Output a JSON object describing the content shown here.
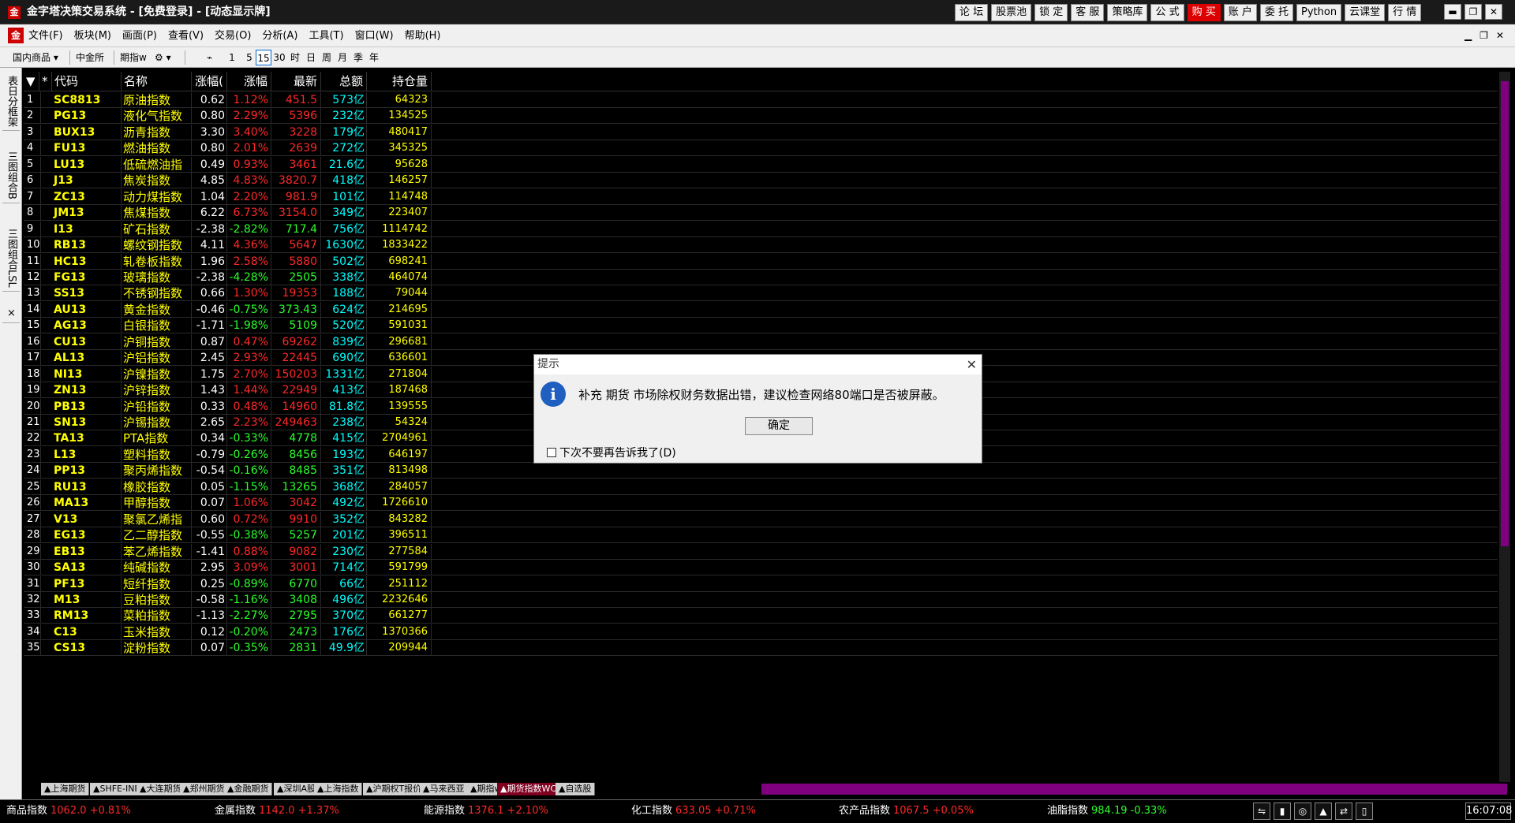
{
  "window": {
    "title": "金字塔决策交易系统 - [免费登录] - [动态显示牌]",
    "logo": "金"
  },
  "title_buttons": [
    "论 坛",
    "股票池",
    "锁 定",
    "客 服",
    "策略库",
    "公 式",
    "购 买",
    "账 户",
    "委 托",
    "Python",
    "云课堂",
    "行 情"
  ],
  "window_controls": [
    "▬",
    "❐",
    "✕"
  ],
  "menu": [
    "文件(F)",
    "板块(M)",
    "画面(P)",
    "查看(V)",
    "交易(O)",
    "分析(A)",
    "工具(T)",
    "窗口(W)",
    "帮助(H)"
  ],
  "menu_right": [
    "▁",
    "❐",
    "✕"
  ],
  "toolbar": {
    "market": "国内商品",
    "exchange": "中金所",
    "index": "期指w",
    "periods": [
      "1",
      "5",
      "15",
      "30",
      "时",
      "日",
      "周",
      "月",
      "季",
      "年"
    ],
    "selected_period": "15"
  },
  "side_tabs": [
    "表日分框架",
    "三图组合B",
    "三图组合LSL",
    "×"
  ],
  "columns": [
    "*",
    "代码",
    "名称",
    "涨幅(",
    "涨幅",
    "最新",
    "总额",
    "持仓量"
  ],
  "rows": [
    {
      "no": "1",
      "code": "SC8813",
      "name": "原油指数",
      "p1": "0.62",
      "pct": "1.12%",
      "last": "451.5",
      "amt": "573亿",
      "oi": "64323",
      "d": "up"
    },
    {
      "no": "2",
      "code": "PG13",
      "name": "液化气指数",
      "p1": "0.80",
      "pct": "2.29%",
      "last": "5396",
      "amt": "232亿",
      "oi": "134525",
      "d": "up"
    },
    {
      "no": "3",
      "code": "BUX13",
      "name": "沥青指数",
      "p1": "3.30",
      "pct": "3.40%",
      "last": "3228",
      "amt": "179亿",
      "oi": "480417",
      "d": "up"
    },
    {
      "no": "4",
      "code": "FU13",
      "name": "燃油指数",
      "p1": "0.80",
      "pct": "2.01%",
      "last": "2639",
      "amt": "272亿",
      "oi": "345325",
      "d": "up"
    },
    {
      "no": "5",
      "code": "LU13",
      "name": "低硫燃油指",
      "p1": "0.49",
      "pct": "0.93%",
      "last": "3461",
      "amt": "21.6亿",
      "oi": "95628",
      "d": "up"
    },
    {
      "no": "6",
      "code": "J13",
      "name": "焦炭指数",
      "p1": "4.85",
      "pct": "4.83%",
      "last": "3820.7",
      "amt": "418亿",
      "oi": "146257",
      "d": "up"
    },
    {
      "no": "7",
      "code": "ZC13",
      "name": "动力煤指数",
      "p1": "1.04",
      "pct": "2.20%",
      "last": "981.9",
      "amt": "101亿",
      "oi": "114748",
      "d": "up"
    },
    {
      "no": "8",
      "code": "JM13",
      "name": "焦煤指数",
      "p1": "6.22",
      "pct": "6.73%",
      "last": "3154.0",
      "amt": "349亿",
      "oi": "223407",
      "d": "up"
    },
    {
      "no": "9",
      "code": "I13",
      "name": "矿石指数",
      "p1": "-2.38",
      "pct": "-2.82%",
      "last": "717.4",
      "amt": "756亿",
      "oi": "1114742",
      "d": "dn"
    },
    {
      "no": "10",
      "code": "RB13",
      "name": "螺纹钢指数",
      "p1": "4.11",
      "pct": "4.36%",
      "last": "5647",
      "amt": "1630亿",
      "oi": "1833422",
      "d": "up"
    },
    {
      "no": "11",
      "code": "HC13",
      "name": "轧卷板指数",
      "p1": "1.96",
      "pct": "2.58%",
      "last": "5880",
      "amt": "502亿",
      "oi": "698241",
      "d": "up"
    },
    {
      "no": "12",
      "code": "FG13",
      "name": "玻璃指数",
      "p1": "-2.38",
      "pct": "-4.28%",
      "last": "2505",
      "amt": "338亿",
      "oi": "464074",
      "d": "dn"
    },
    {
      "no": "13",
      "code": "SS13",
      "name": "不锈钢指数",
      "p1": "0.66",
      "pct": "1.30%",
      "last": "19353",
      "amt": "188亿",
      "oi": "79044",
      "d": "up"
    },
    {
      "no": "14",
      "code": "AU13",
      "name": "黄金指数",
      "p1": "-0.46",
      "pct": "-0.75%",
      "last": "373.43",
      "amt": "624亿",
      "oi": "214695",
      "d": "dn"
    },
    {
      "no": "15",
      "code": "AG13",
      "name": "白银指数",
      "p1": "-1.71",
      "pct": "-1.98%",
      "last": "5109",
      "amt": "520亿",
      "oi": "591031",
      "d": "dn"
    },
    {
      "no": "16",
      "code": "CU13",
      "name": "沪铜指数",
      "p1": "0.87",
      "pct": "0.47%",
      "last": "69262",
      "amt": "839亿",
      "oi": "296681",
      "d": "up"
    },
    {
      "no": "17",
      "code": "AL13",
      "name": "沪铝指数",
      "p1": "2.45",
      "pct": "2.93%",
      "last": "22445",
      "amt": "690亿",
      "oi": "636601",
      "d": "up"
    },
    {
      "no": "18",
      "code": "NI13",
      "name": "沪镍指数",
      "p1": "1.75",
      "pct": "2.70%",
      "last": "150203",
      "amt": "1331亿",
      "oi": "271804",
      "d": "up"
    },
    {
      "no": "19",
      "code": "ZN13",
      "name": "沪锌指数",
      "p1": "1.43",
      "pct": "1.44%",
      "last": "22949",
      "amt": "413亿",
      "oi": "187468",
      "d": "up"
    },
    {
      "no": "20",
      "code": "PB13",
      "name": "沪铅指数",
      "p1": "0.33",
      "pct": "0.48%",
      "last": "14960",
      "amt": "81.8亿",
      "oi": "139555",
      "d": "up"
    },
    {
      "no": "21",
      "code": "SN13",
      "name": "沪锡指数",
      "p1": "2.65",
      "pct": "2.23%",
      "last": "249463",
      "amt": "238亿",
      "oi": "54324",
      "d": "up"
    },
    {
      "no": "22",
      "code": "TA13",
      "name": "PTA指数",
      "p1": "0.34",
      "pct": "-0.33%",
      "last": "4778",
      "amt": "415亿",
      "oi": "2704961",
      "d": "dn"
    },
    {
      "no": "23",
      "code": "L13",
      "name": "塑料指数",
      "p1": "-0.79",
      "pct": "-0.26%",
      "last": "8456",
      "amt": "193亿",
      "oi": "646197",
      "d": "dn"
    },
    {
      "no": "24",
      "code": "PP13",
      "name": "聚丙烯指数",
      "p1": "-0.54",
      "pct": "-0.16%",
      "last": "8485",
      "amt": "351亿",
      "oi": "813498",
      "d": "dn"
    },
    {
      "no": "25",
      "code": "RU13",
      "name": "橡胶指数",
      "p1": "0.05",
      "pct": "-1.15%",
      "last": "13265",
      "amt": "368亿",
      "oi": "284057",
      "d": "dn"
    },
    {
      "no": "26",
      "code": "MA13",
      "name": "甲醇指数",
      "p1": "0.07",
      "pct": "1.06%",
      "last": "3042",
      "amt": "492亿",
      "oi": "1726610",
      "d": "up"
    },
    {
      "no": "27",
      "code": "V13",
      "name": "聚氯乙烯指",
      "p1": "0.60",
      "pct": "0.72%",
      "last": "9910",
      "amt": "352亿",
      "oi": "843282",
      "d": "up"
    },
    {
      "no": "28",
      "code": "EG13",
      "name": "乙二醇指数",
      "p1": "-0.55",
      "pct": "-0.38%",
      "last": "5257",
      "amt": "201亿",
      "oi": "396511",
      "d": "dn"
    },
    {
      "no": "29",
      "code": "EB13",
      "name": "苯乙烯指数",
      "p1": "-1.41",
      "pct": "0.88%",
      "last": "9082",
      "amt": "230亿",
      "oi": "277584",
      "d": "up"
    },
    {
      "no": "30",
      "code": "SA13",
      "name": "纯碱指数",
      "p1": "2.95",
      "pct": "3.09%",
      "last": "3001",
      "amt": "714亿",
      "oi": "591799",
      "d": "up"
    },
    {
      "no": "31",
      "code": "PF13",
      "name": "短纤指数",
      "p1": "0.25",
      "pct": "-0.89%",
      "last": "6770",
      "amt": "66亿",
      "oi": "251112",
      "d": "dn"
    },
    {
      "no": "32",
      "code": "M13",
      "name": "豆粕指数",
      "p1": "-0.58",
      "pct": "-1.16%",
      "last": "3408",
      "amt": "496亿",
      "oi": "2232646",
      "d": "dn"
    },
    {
      "no": "33",
      "code": "RM13",
      "name": "菜粕指数",
      "p1": "-1.13",
      "pct": "-2.27%",
      "last": "2795",
      "amt": "370亿",
      "oi": "661277",
      "d": "dn"
    },
    {
      "no": "34",
      "code": "C13",
      "name": "玉米指数",
      "p1": "0.12",
      "pct": "-0.20%",
      "last": "2473",
      "amt": "176亿",
      "oi": "1370366",
      "d": "dn"
    },
    {
      "no": "35",
      "code": "CS13",
      "name": "淀粉指数",
      "p1": "0.07",
      "pct": "-0.35%",
      "last": "2831",
      "amt": "49.9亿",
      "oi": "209944",
      "d": "dn"
    }
  ],
  "bottom_tabs": [
    "▲上海期货",
    "▲SHFE-INE",
    "▲大连期货",
    "▲郑州期货",
    "▲金融期货",
    "▲深圳A股",
    "▲上海指数",
    "▲沪期权T报价",
    "▲马来西亚",
    "▲期指w",
    "▲期货指数WCR",
    "▲自选股"
  ],
  "active_bottom_tab": "▲期货指数WCR",
  "status": [
    {
      "label": "商品指数",
      "value": "1062.0 +0.81%"
    },
    {
      "label": "金属指数",
      "value": "1142.0 +1.37%"
    },
    {
      "label": "能源指数",
      "value": "1376.1 +2.10%"
    },
    {
      "label": "化工指数",
      "value": "633.05 +0.71%"
    },
    {
      "label": "农产品指数",
      "value": "1067.5 +0.05%"
    },
    {
      "label": "油脂指数",
      "value": "984.19 -0.33%"
    }
  ],
  "status_icons": [
    "⇋",
    "▮",
    "◎",
    "▲",
    "⇄",
    "▯"
  ],
  "clock": "16:07:08",
  "dialog": {
    "title": "提示",
    "close": "✕",
    "icon": "i",
    "message": "补充 期货 市场除权财务数据出错，建议检查网络80端口是否被屏蔽。",
    "ok": "确定",
    "checkbox": "下次不要再告诉我了(D)"
  },
  "colors": {
    "up": "#ff2828",
    "down": "#2bff2b",
    "code": "#ffff00",
    "amount": "#00ffff",
    "active_tab": "#800020",
    "scroll": "#800080"
  }
}
